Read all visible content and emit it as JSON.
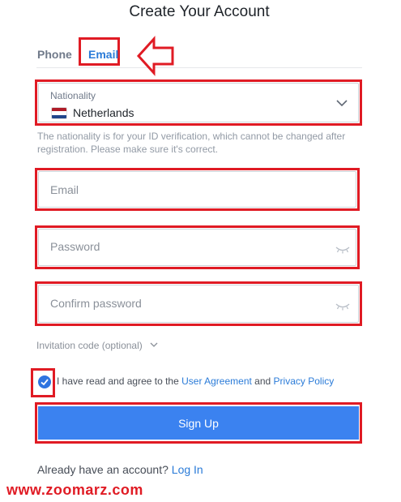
{
  "page": {
    "title": "Create Your Account"
  },
  "tabs": {
    "phone": "Phone",
    "email": "Email",
    "active": "Email"
  },
  "nationality": {
    "label": "Nationality",
    "value": "Netherlands",
    "flag_icon": "netherlands-flag-icon",
    "note": "The nationality is for your ID verification, which cannot be changed after registration. Please make sure it's correct."
  },
  "fields": {
    "email_placeholder": "Email",
    "password_placeholder": "Password",
    "confirm_placeholder": "Confirm password"
  },
  "invitation": {
    "label": "Invitation code (optional)"
  },
  "agreement": {
    "checked": true,
    "prefix": "I have read and agree to the ",
    "user_agreement": "User Agreement",
    "and": " and ",
    "privacy_policy": "Privacy Policy"
  },
  "actions": {
    "signup_label": "Sign Up"
  },
  "footer": {
    "already_text": "Already have an account? ",
    "login_label": "Log In"
  },
  "watermark": {
    "text": "www.zoomarz.com"
  },
  "colors": {
    "accent": "#2a7bd8",
    "button": "#3b82f0",
    "highlight": "#e01b24"
  }
}
